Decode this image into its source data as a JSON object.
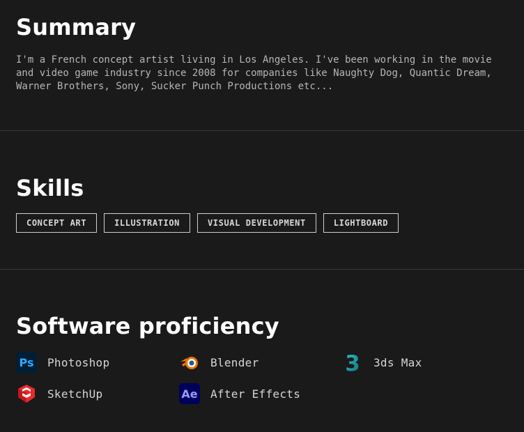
{
  "summary": {
    "title": "Summary",
    "text": "I'm a French concept artist living in Los Angeles. I've been working in the movie and video game industry since 2008 for companies like Naughty Dog, Quantic Dream, Warner Brothers, Sony, Sucker Punch Productions etc..."
  },
  "skills": {
    "title": "Skills",
    "items": [
      "CONCEPT ART",
      "ILLUSTRATION",
      "VISUAL DEVELOPMENT",
      "LIGHTBOARD"
    ]
  },
  "software": {
    "title": "Software proficiency",
    "items": [
      {
        "name": "Photoshop",
        "icon": "photoshop-icon",
        "icon_text": "Ps"
      },
      {
        "name": "Blender",
        "icon": "blender-icon"
      },
      {
        "name": "3ds Max",
        "icon": "3ds-max-icon",
        "icon_text": "3"
      },
      {
        "name": "SketchUp",
        "icon": "sketchup-icon"
      },
      {
        "name": "After Effects",
        "icon": "after-effects-icon",
        "icon_text": "Ae"
      }
    ]
  },
  "colors": {
    "background": "#1a1a1a",
    "photoshop": "#31a8ff",
    "photoshop_bg": "#001e36",
    "after_effects": "#9999ff",
    "after_effects_bg": "#00005b",
    "blender": "#ea7600",
    "max": "#1c9ea6",
    "sketchup": "#e72b2d"
  }
}
